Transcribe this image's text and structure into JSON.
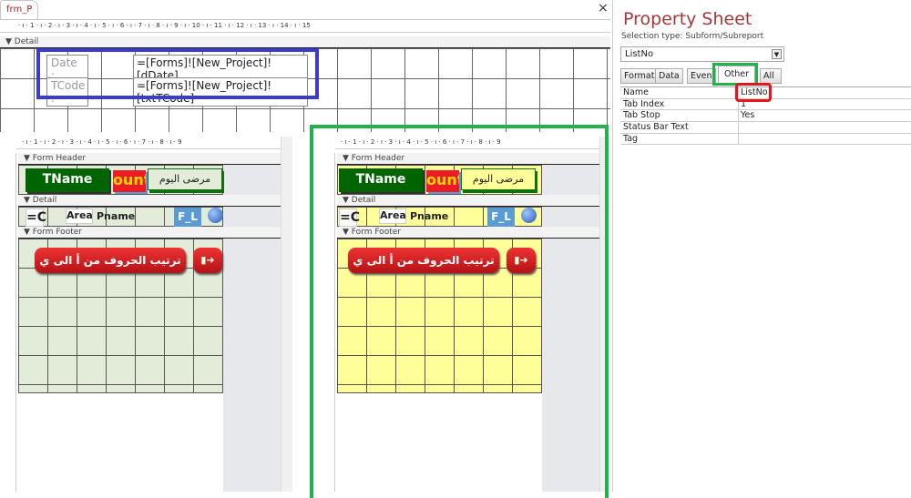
{
  "document_tab": {
    "label": "frm_P"
  },
  "close_glyph": "×",
  "ruler": {
    "top": "· ı · 1 · ı · 2 · ı · 3 · ı · 4 · ı · 5 · ı · 6 · ı · 7 · ı · 8 · ı · 9 · ı · 10 · ı · 11 · ı · 12 · ı · 13 · ı · 14 · ı · 15",
    "sub": "· ı · 1 · ı · 2 · ı · 3 · ı · 4 · ı · 5 · ı · 6 · ı · 7 · ı · 8 · ı · 9"
  },
  "detail": {
    "section": "Detail",
    "date_label": "Date :",
    "date_value": "=[Forms]![New_Project]![dDate]",
    "tcode_label": "TCode :",
    "tcode_value": "=[Forms]![New_Project]![txtTCode]"
  },
  "subforms": [
    {
      "bg": "#e3ecd9",
      "header": "Form Header",
      "detail": "Detail",
      "footer": "Form Footer",
      "tname": "TName",
      "count": "ount",
      "today": "مرضى اليوم",
      "eqc": "=C",
      "area": "Area",
      "pname": "Pname",
      "fl": "F_L",
      "sort_button": "ترتيب الحروف من أ الى ي",
      "exit_icon": "exit-door-icon"
    },
    {
      "bg": "#ffff99",
      "header": "Form Header",
      "detail": "Detail",
      "footer": "Form Footer",
      "tname": "TName",
      "count": "ount",
      "today": "مرضى اليوم",
      "eqc": "=C",
      "area": "Area",
      "pname": "Pname",
      "fl": "F_L",
      "sort_button": "ترتيب الحروف من أ الى ي",
      "exit_icon": "exit-door-icon"
    }
  ],
  "property_sheet": {
    "title": "Property Sheet",
    "selection_type": "Selection type:  Subform/Subreport",
    "selected_object": "ListNo",
    "tabs": [
      "Format",
      "Data",
      "Event",
      "Other",
      "All"
    ],
    "active_tab": "Other",
    "rows": [
      {
        "k": "Name",
        "v": "ListNo"
      },
      {
        "k": "Tab Index",
        "v": "1"
      },
      {
        "k": "Tab Stop",
        "v": "Yes"
      },
      {
        "k": "Status Bar Text",
        "v": ""
      },
      {
        "k": "Tag",
        "v": ""
      }
    ]
  },
  "colors": {
    "highlight_blue": "#3c3cc8",
    "highlight_green": "#22b14c",
    "highlight_red": "#e8141c",
    "title": "#a4373a"
  }
}
